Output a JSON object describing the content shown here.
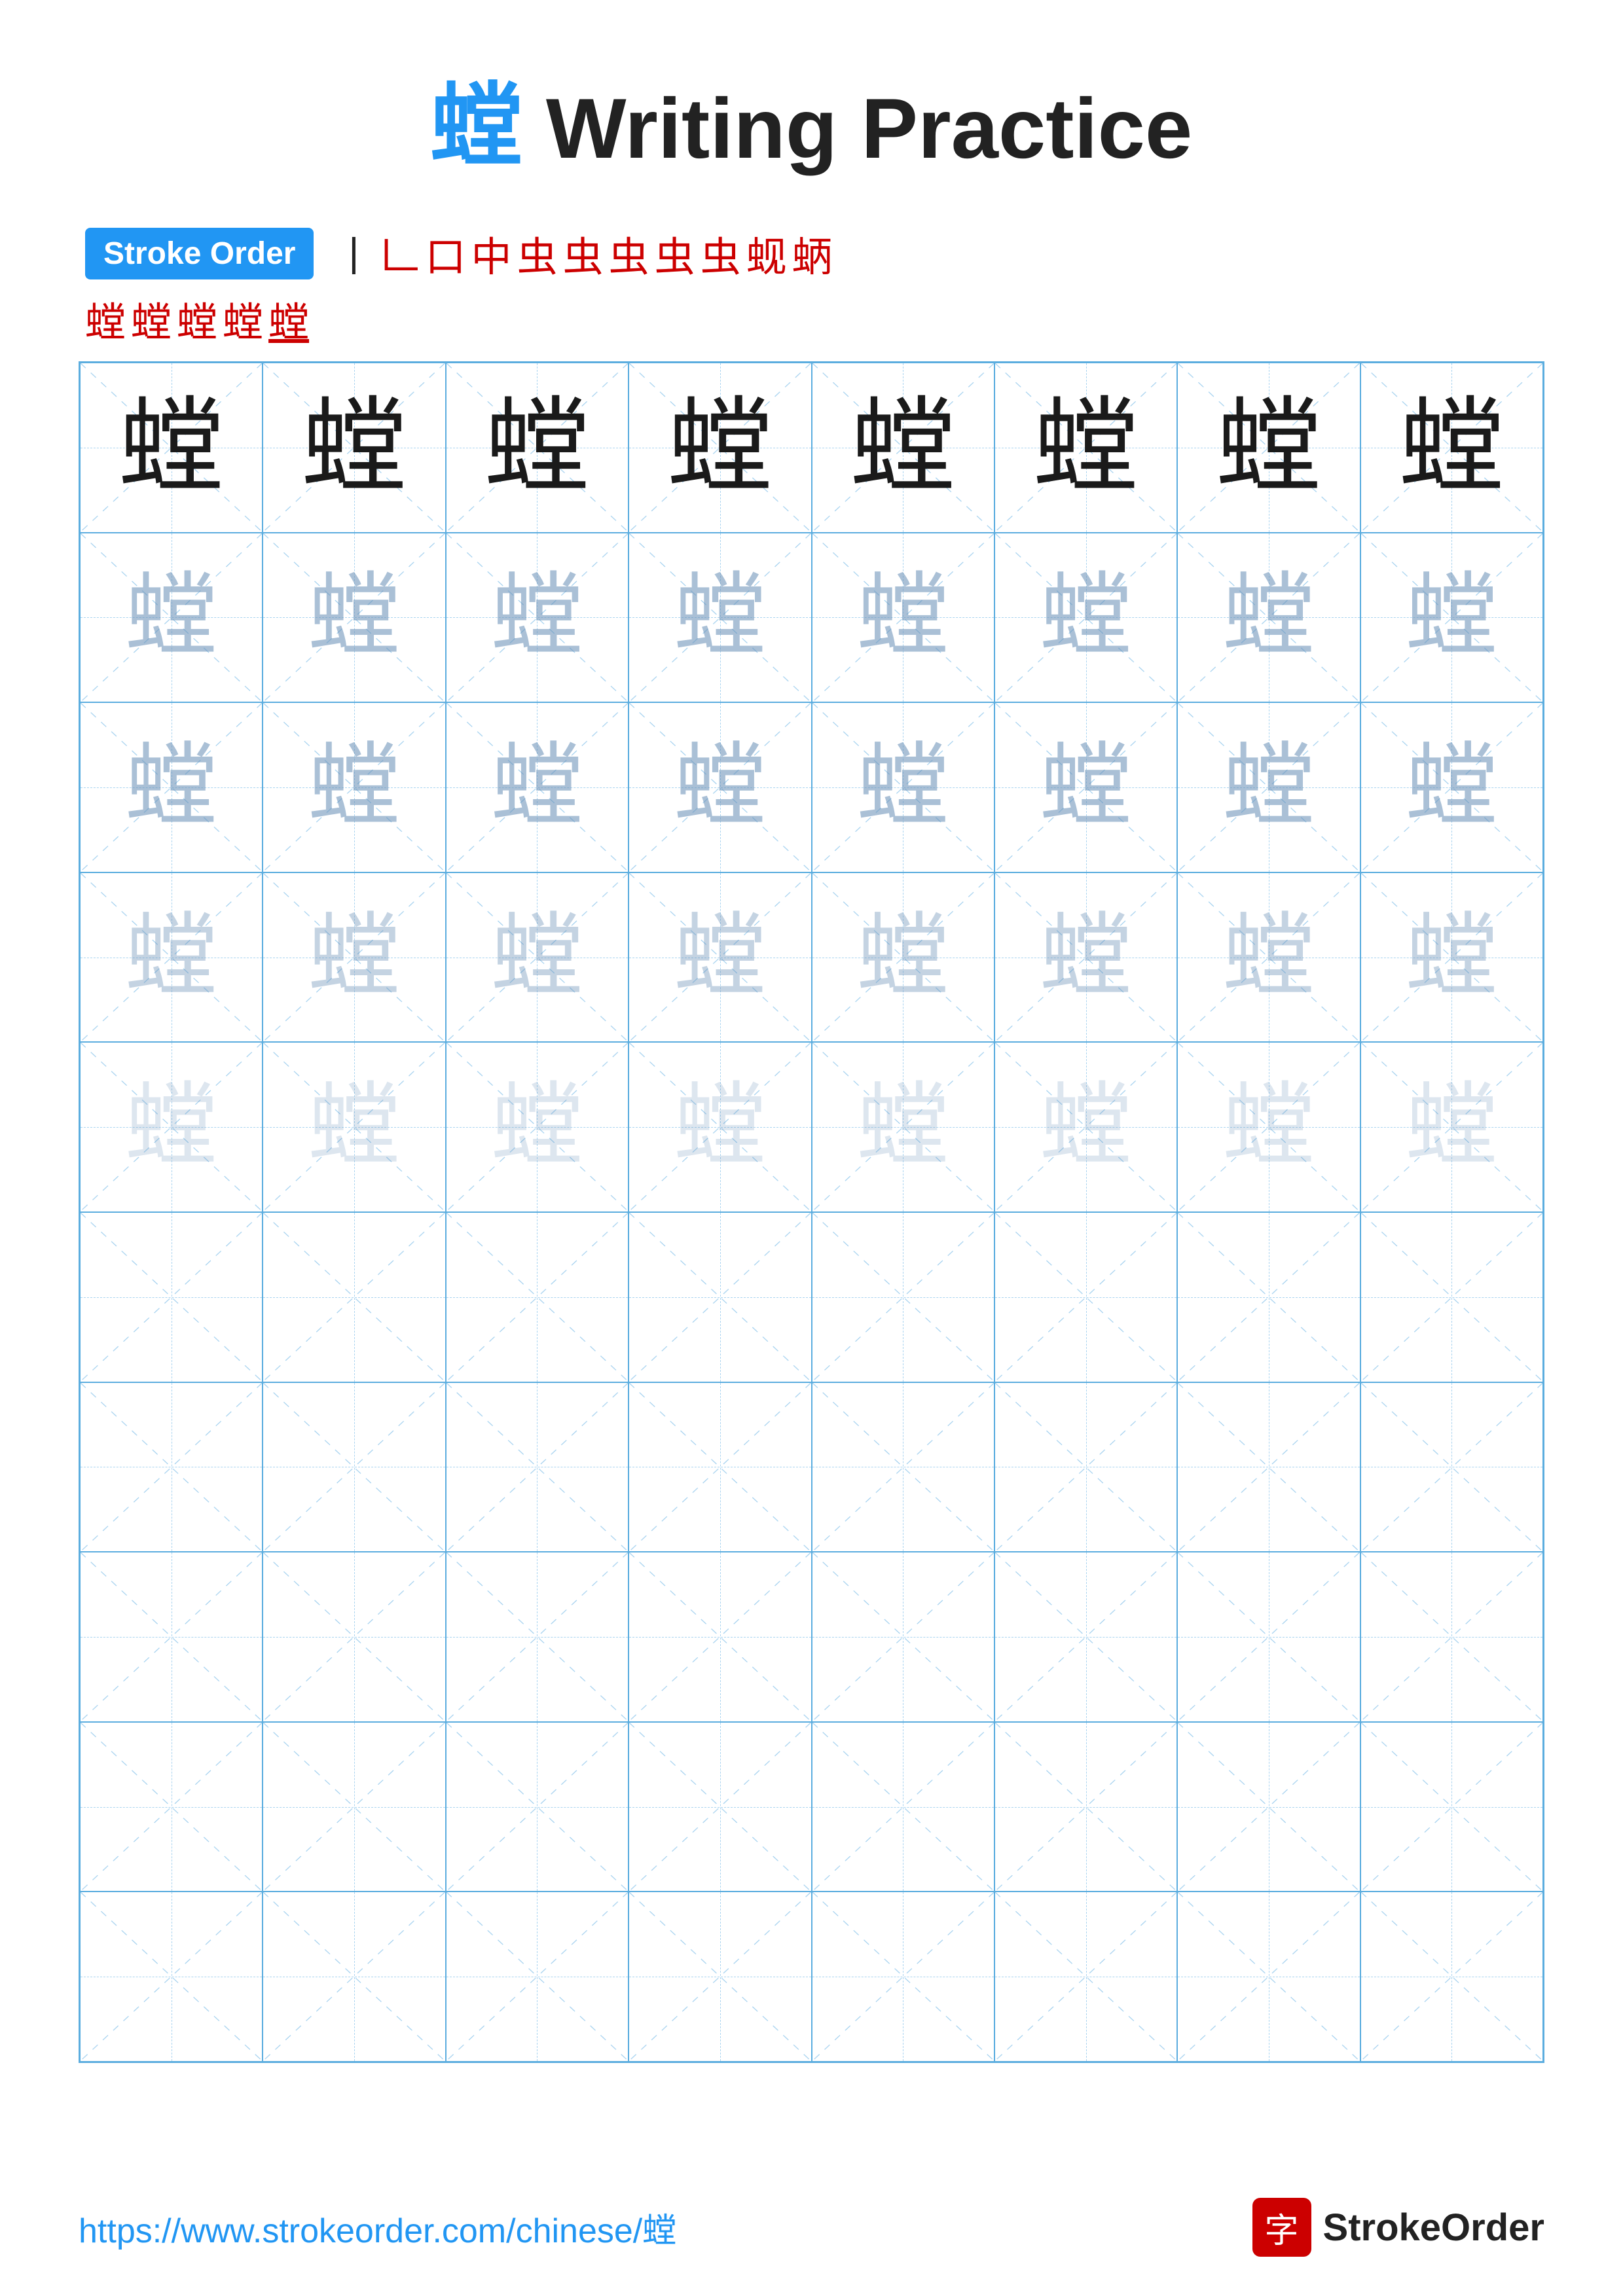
{
  "title": {
    "char": "螳",
    "text": " Writing Practice"
  },
  "stroke_order": {
    "badge_label": "Stroke Order",
    "strokes": [
      "丨",
      "𠃊",
      "口",
      "中",
      "虫",
      "虫",
      "虫'",
      "虫'",
      "虫'",
      "虫'꜀",
      "虫'꜀",
      "蚬",
      "蛃",
      "螳",
      "螳",
      "螳"
    ]
  },
  "practice": {
    "char": "螳",
    "rows": 10,
    "cols": 8
  },
  "footer": {
    "url": "https://www.strokeorder.com/chinese/螳",
    "logo_char": "字",
    "logo_text": "StrokeOrder"
  }
}
